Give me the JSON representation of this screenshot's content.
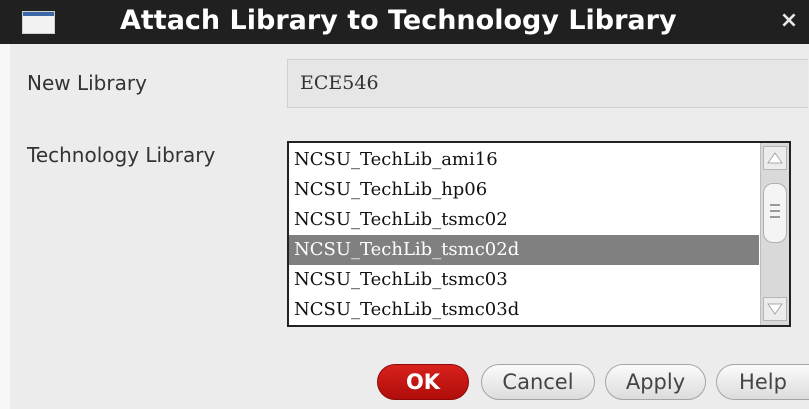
{
  "window": {
    "title": "Attach Library to Technology Library",
    "close_glyph": "×"
  },
  "form": {
    "new_library": {
      "label": "New Library",
      "value": "ECE546"
    },
    "technology_library": {
      "label": "Technology Library",
      "items": [
        {
          "label": "NCSU_TechLib_ami16",
          "selected": false
        },
        {
          "label": "NCSU_TechLib_hp06",
          "selected": false
        },
        {
          "label": "NCSU_TechLib_tsmc02",
          "selected": false
        },
        {
          "label": "NCSU_TechLib_tsmc02d",
          "selected": true
        },
        {
          "label": "NCSU_TechLib_tsmc03",
          "selected": false
        },
        {
          "label": "NCSU_TechLib_tsmc03d",
          "selected": false
        }
      ]
    }
  },
  "buttons": {
    "ok": "OK",
    "cancel": "Cancel",
    "apply": "Apply",
    "help": "Help"
  },
  "colors": {
    "titlebar": "#202020",
    "dialog_bg": "#ececec",
    "ok_button": "#c4140f",
    "selection": "#808080"
  },
  "icons": {
    "window": "window-icon",
    "close": "close-icon",
    "scroll_up": "arrow-up-icon",
    "scroll_down": "arrow-down-icon"
  }
}
